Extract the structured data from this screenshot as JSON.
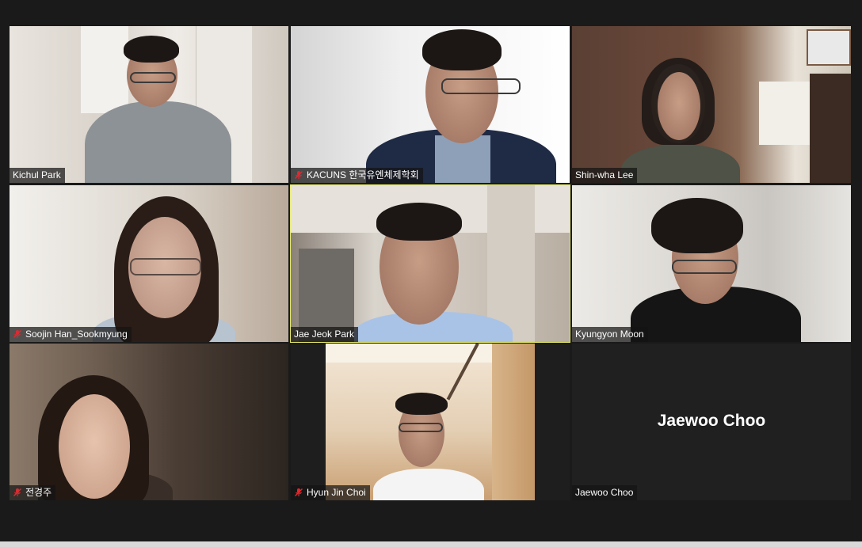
{
  "participants": [
    {
      "name": "Kichul Park",
      "muted": false
    },
    {
      "name": "KACUNS 한국유엔체제학회",
      "muted": true
    },
    {
      "name": "Shin-wha Lee",
      "muted": false
    },
    {
      "name": "Soojin Han_Sookmyung",
      "muted": true
    },
    {
      "name": "Jae Jeok Park",
      "muted": false
    },
    {
      "name": "Kyungyon Moon",
      "muted": false
    },
    {
      "name": "전경주",
      "muted": true
    },
    {
      "name": "Hyun Jin Choi",
      "muted": true
    },
    {
      "name": "Jaewoo Choo",
      "muted": false,
      "video_off": true,
      "avatar_text": "Jaewoo Choo"
    }
  ],
  "active_speaker_index": 4,
  "colors": {
    "background": "#1a1a1a",
    "active_outline": "#e3e76a",
    "mute_icon": "#e0282e",
    "label_text": "#ffffff"
  },
  "icons": {
    "muted": "microphone-muted-icon"
  }
}
